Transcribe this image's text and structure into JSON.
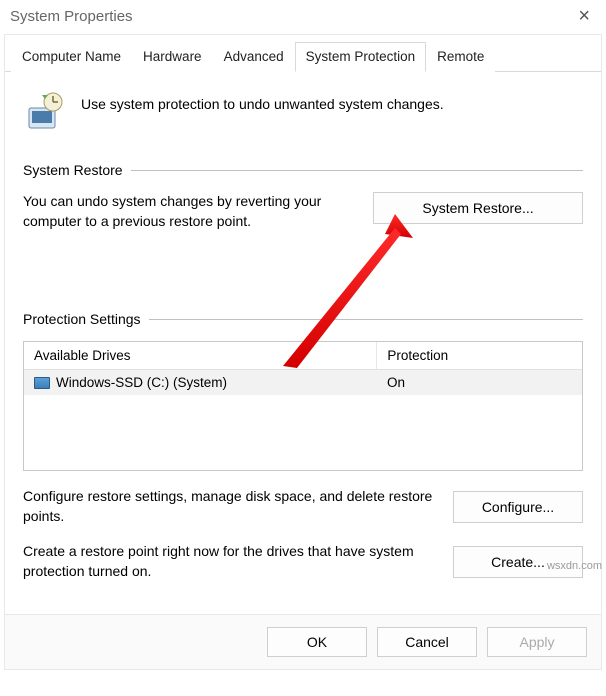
{
  "window": {
    "title": "System Properties"
  },
  "tabs": {
    "computer_name": "Computer Name",
    "hardware": "Hardware",
    "advanced": "Advanced",
    "system_protection": "System Protection",
    "remote": "Remote"
  },
  "intro": {
    "text": "Use system protection to undo unwanted system changes."
  },
  "restore_group": {
    "title": "System Restore",
    "description": "You can undo system changes by reverting your computer to a previous restore point.",
    "button": "System Restore..."
  },
  "protection_group": {
    "title": "Protection Settings",
    "col_drives": "Available Drives",
    "col_protection": "Protection",
    "rows": [
      {
        "drive": "Windows-SSD (C:) (System)",
        "protection": "On"
      }
    ],
    "configure_text": "Configure restore settings, manage disk space, and delete restore points.",
    "configure_button": "Configure...",
    "create_text": "Create a restore point right now for the drives that have system protection turned on.",
    "create_button": "Create..."
  },
  "footer": {
    "ok": "OK",
    "cancel": "Cancel",
    "apply": "Apply"
  },
  "watermark": "wsxdn.com"
}
